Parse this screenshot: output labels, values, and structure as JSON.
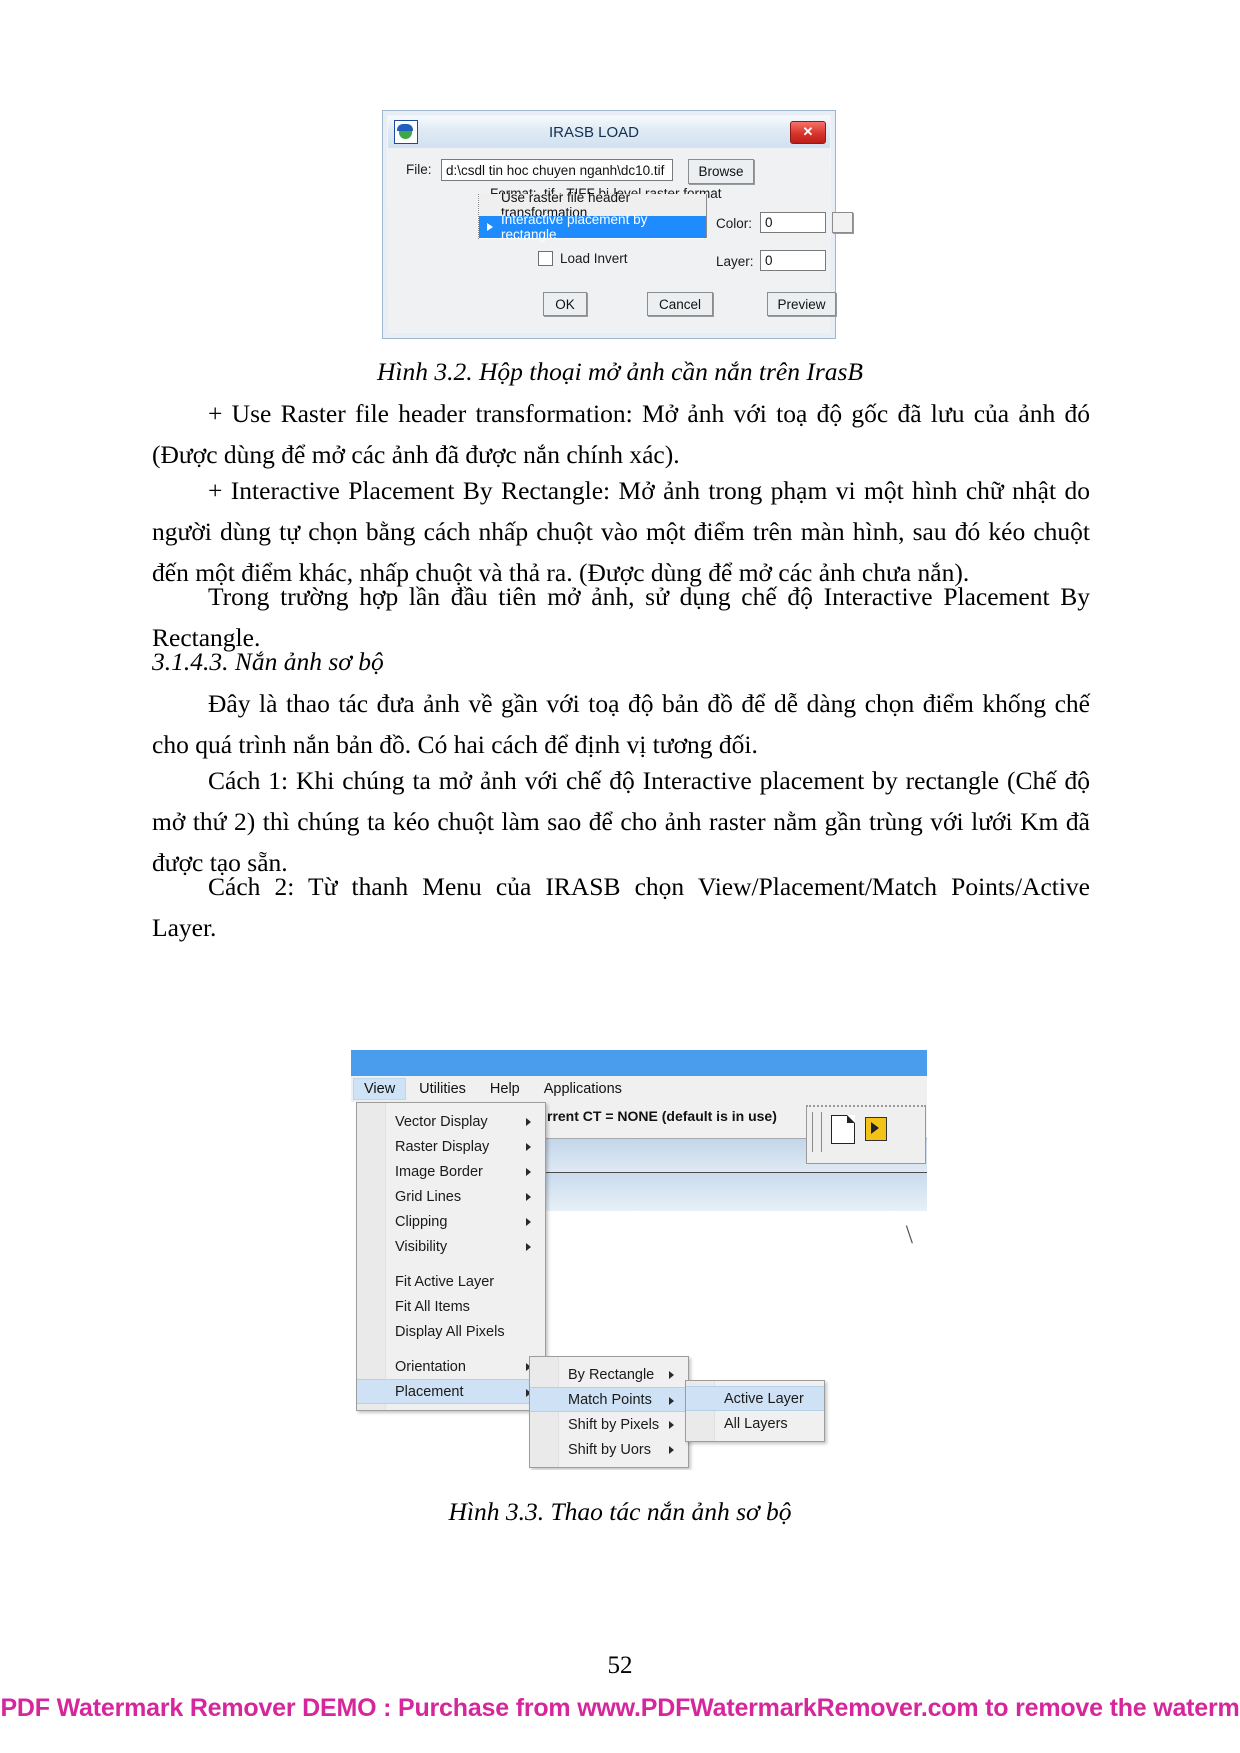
{
  "document": {
    "page_number": "52",
    "watermark": "PDF Watermark Remover DEMO : Purchase from www.PDFWatermarkRemover.com to remove the waterm"
  },
  "figure_3_2": {
    "caption": "Hình 3.2. Hộp thoại mở ảnh cần nắn trên IrasB",
    "dialog": {
      "title": "IRASB LOAD",
      "icon": "irasb-app-icon",
      "close_label": "✕",
      "file_label": "File:",
      "file_value": "d:\\csdl tin hoc chuyen nganh\\dc10.tif",
      "browse_label": "Browse",
      "format_label": "Format:  .tif  ·  TIFF bi-level raster format",
      "options": [
        "Use raster file header transformation",
        "Interactive placement by rectangle"
      ],
      "selected_option": "Interactive placement by rectangle",
      "color_label": "Color:",
      "color_value": "0",
      "layer_label": "Layer:",
      "layer_value": "0",
      "load_invert_label": "Load Invert",
      "ok_label": "OK",
      "cancel_label": "Cancel",
      "preview_label": "Preview",
      "accent_color": "#1e8bff"
    }
  },
  "paragraphs": {
    "p1": "+ Use Raster file header transformation: Mở ảnh với toạ độ gốc đã lưu của ảnh đó (Được dùng để mở các ảnh đã được nắn chính xác).",
    "p2": "+ Interactive Placement By Rectangle: Mở ảnh trong phạm vi một hình chữ nhật do người dùng tự chọn bằng cách nhấp chuột vào một điểm trên màn hình, sau đó kéo chuột đến một điểm khác, nhấp chuột và thả ra. (Được dùng để mở các ảnh chưa nắn).",
    "p3": "Trong trường hợp lần đầu tiên mở ảnh, sử dụng chế độ Interactive Placement By Rectangle.",
    "heading": "3.1.4.3. Nắn ảnh sơ bộ",
    "p4": "Đây là thao tác đưa ảnh về gần với toạ độ bản đồ để dễ dàng chọn điểm khống chế cho quá trình nắn bản đồ. Có hai cách để định vị tương đối.",
    "p5": "Cách 1: Khi chúng ta mở ảnh với chế độ Interactive placement by rectangle (Chế độ mở thứ 2) thì chúng ta kéo chuột làm sao để cho ảnh raster nằm gần trùng với lưới Km đã được tạo sẵn.",
    "p6": "Cách 2: Từ thanh Menu của IRASB chọn View/Placement/Match Points/Active Layer."
  },
  "figure_3_3": {
    "caption": "Hình 3.3. Thao tác nắn ảnh sơ bộ",
    "screenshot": {
      "menubar": [
        {
          "label": "View",
          "active": true
        },
        {
          "label": "Utilities",
          "active": false
        },
        {
          "label": "Help",
          "active": false
        },
        {
          "label": "Applications",
          "active": false
        }
      ],
      "status_text": "rrent CT = NONE (default is in use)",
      "view_menu": [
        {
          "label": "Vector Display",
          "submenu": true,
          "highlighted": false,
          "separator_before": false
        },
        {
          "label": "Raster Display",
          "submenu": true,
          "highlighted": false,
          "separator_before": false
        },
        {
          "label": "Image Border",
          "submenu": true,
          "highlighted": false,
          "separator_before": false
        },
        {
          "label": "Grid Lines",
          "submenu": true,
          "highlighted": false,
          "separator_before": false
        },
        {
          "label": "Clipping",
          "submenu": true,
          "highlighted": false,
          "separator_before": false
        },
        {
          "label": "Visibility",
          "submenu": true,
          "highlighted": false,
          "separator_before": false
        },
        {
          "label": "Fit Active Layer",
          "submenu": false,
          "highlighted": false,
          "separator_before": true
        },
        {
          "label": "Fit All Items",
          "submenu": false,
          "highlighted": false,
          "separator_before": false
        },
        {
          "label": "Display All Pixels",
          "submenu": false,
          "highlighted": false,
          "separator_before": false
        },
        {
          "label": "Orientation",
          "submenu": true,
          "highlighted": false,
          "separator_before": true
        },
        {
          "label": "Placement",
          "submenu": true,
          "highlighted": true,
          "separator_before": false
        }
      ],
      "placement_menu": [
        {
          "label": "By Rectangle",
          "submenu": true,
          "highlighted": false
        },
        {
          "label": "Match Points",
          "submenu": true,
          "highlighted": true
        },
        {
          "label": "Shift by Pixels",
          "submenu": true,
          "highlighted": false
        },
        {
          "label": "Shift by Uors",
          "submenu": true,
          "highlighted": false
        }
      ],
      "match_points_menu": [
        {
          "label": "Active Layer",
          "submenu": false,
          "highlighted": true
        },
        {
          "label": "All Layers",
          "submenu": false,
          "highlighted": false
        }
      ],
      "titlebar_color": "#4a9cec",
      "highlight_color": "#cfe1f5"
    }
  }
}
